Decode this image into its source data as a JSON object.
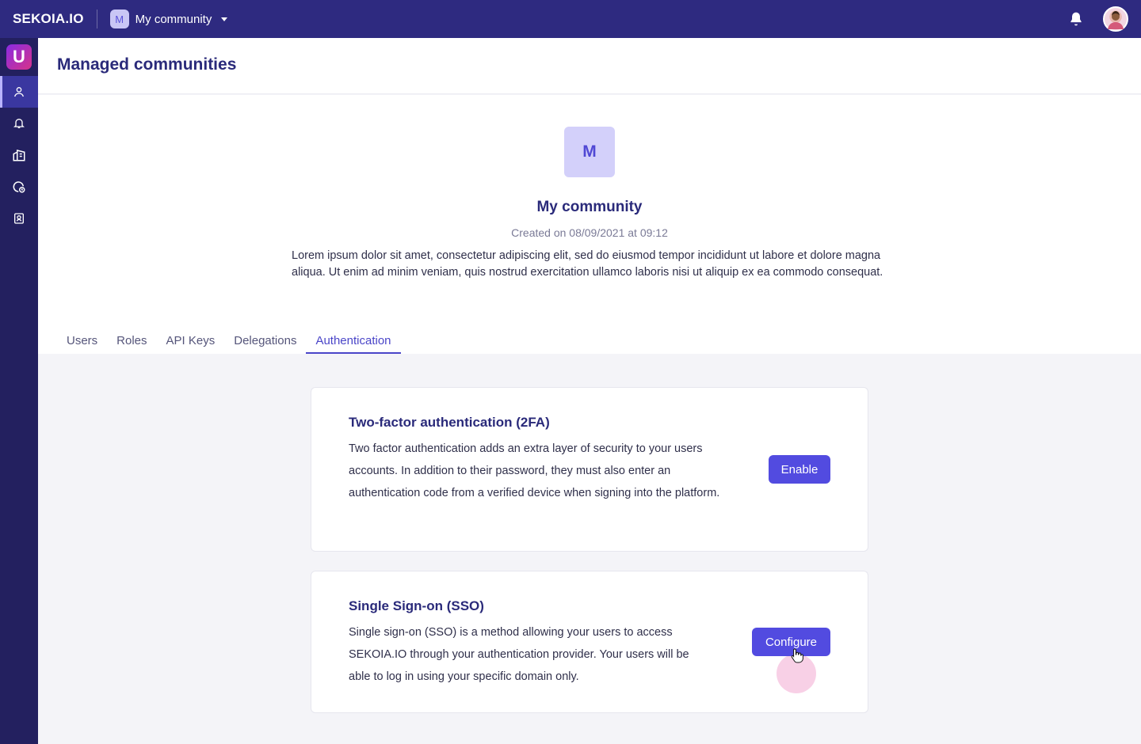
{
  "topbar": {
    "brand": "SEKOIA.IO",
    "community_initial": "M",
    "community_name": "My community"
  },
  "sidebar": {
    "app_initial": "U",
    "items": [
      {
        "icon": "user-icon",
        "active": true
      },
      {
        "icon": "bell-icon",
        "active": false
      },
      {
        "icon": "buildings-icon",
        "active": false
      },
      {
        "icon": "shield-clock-icon",
        "active": false
      },
      {
        "icon": "contact-card-icon",
        "active": false
      }
    ]
  },
  "page": {
    "title": "Managed communities"
  },
  "community": {
    "initial": "M",
    "name": "My community",
    "created": "Created on 08/09/2021 at 09:12",
    "description": "Lorem ipsum dolor sit amet, consectetur adipiscing elit, sed do eiusmod tempor incididunt ut labore et dolore magna aliqua. Ut enim ad minim veniam, quis nostrud exercitation ullamco laboris nisi ut aliquip ex ea commodo consequat."
  },
  "tabs": [
    {
      "label": "Users",
      "active": false
    },
    {
      "label": "Roles",
      "active": false
    },
    {
      "label": "API Keys",
      "active": false
    },
    {
      "label": "Delegations",
      "active": false
    },
    {
      "label": "Authentication",
      "active": true
    }
  ],
  "cards": {
    "twofa": {
      "title": "Two-factor authentication (2FA)",
      "text": "Two factor authentication adds an extra layer of security to your users accounts. In addition to their password, they must also enter an authentication code from a verified device when signing into the platform.",
      "button": "Enable"
    },
    "sso": {
      "title": "Single Sign-on (SSO)",
      "text": "Single sign-on (SSO) is a method allowing your users to access SEKOIA.IO through your authentication provider. Your users will be able to log in using your specific domain only.",
      "button": "Configure"
    }
  },
  "colors": {
    "topbar": "#2e2a80",
    "sidebar": "#23205f",
    "accent": "#524be0"
  }
}
